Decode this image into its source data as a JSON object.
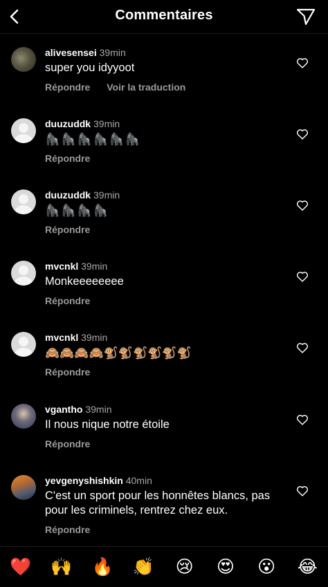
{
  "header": {
    "title": "Commentaires"
  },
  "comments": [
    {
      "user": "alivesensei",
      "time": "39min",
      "text": "super you idyyoot",
      "reply": "Répondre",
      "translate": "Voir la traduction"
    },
    {
      "user": "duuzuddk",
      "time": "39min",
      "text": "🦍🦍🦍🦍🦍🦍",
      "reply": "Répondre"
    },
    {
      "user": "duuzuddk",
      "time": "39min",
      "text": "🦍🦍🦍🦍",
      "reply": "Répondre"
    },
    {
      "user": "mvcnkl",
      "time": "39min",
      "text": "Monkeeeeeeee",
      "reply": "Répondre"
    },
    {
      "user": "mvcnkl",
      "time": "39min",
      "text": "🙈🙈🙈🙈🐒🐒🐒🐒🐒🐒",
      "reply": "Répondre"
    },
    {
      "user": "vgantho",
      "time": "39min",
      "text": "Il nous nique notre étoile",
      "reply": "Répondre"
    },
    {
      "user": "yevgenyshishkin",
      "time": "40min",
      "text": "C'est un sport pour les honnêtes blancs, pas pour les criminels, rentrez chez eux.",
      "reply": "Répondre"
    }
  ],
  "reactions": [
    "❤️",
    "🙌",
    "🔥",
    "👏",
    "😢",
    "😍",
    "😮",
    "😂"
  ],
  "icons": {
    "back": "chevron-left-icon",
    "send": "paper-plane-icon",
    "like": "heart-outline-icon",
    "avatar_default": "default-avatar-icon"
  }
}
